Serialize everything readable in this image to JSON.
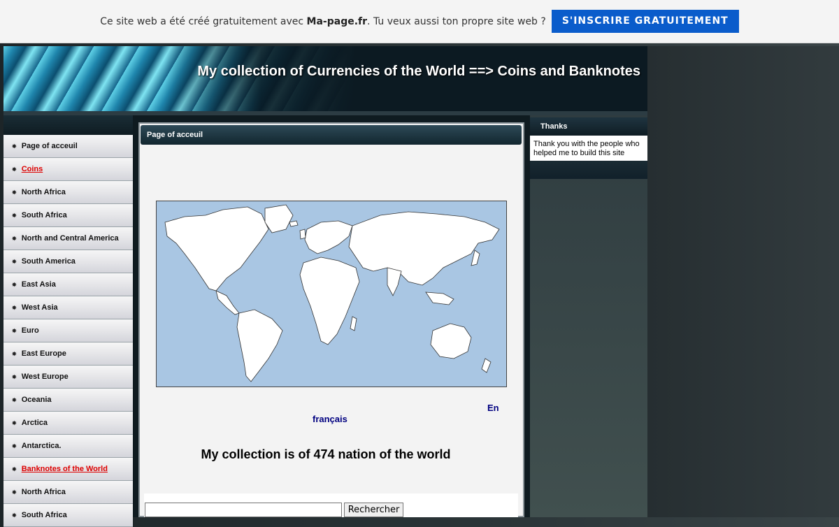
{
  "promo": {
    "text_before": "Ce site web a été créé gratuitement avec ",
    "brand": "Ma-page.fr",
    "text_after": ". Tu veux aussi ton propre site web ?",
    "button": "S'INSCRIRE GRATUITEMENT"
  },
  "banner": {
    "title": "My collection of Currencies of the World ==> Coins and Banknotes"
  },
  "nav": {
    "items": [
      {
        "label": "Page of acceuil",
        "active": false
      },
      {
        "label": "Coins",
        "active": true
      },
      {
        "label": "North Africa",
        "active": false
      },
      {
        "label": "South Africa",
        "active": false
      },
      {
        "label": "North and Central America",
        "active": false
      },
      {
        "label": "South America",
        "active": false
      },
      {
        "label": "East Asia",
        "active": false
      },
      {
        "label": "West Asia",
        "active": false
      },
      {
        "label": "Euro",
        "active": false
      },
      {
        "label": "East Europe",
        "active": false
      },
      {
        "label": "West Europe",
        "active": false
      },
      {
        "label": "Oceania",
        "active": false
      },
      {
        "label": "Arctica",
        "active": false
      },
      {
        "label": "Antarctica.",
        "active": false
      },
      {
        "label": "Banknotes of the World",
        "active": true
      },
      {
        "label": "North Africa",
        "active": false
      },
      {
        "label": "South Africa",
        "active": false
      }
    ]
  },
  "main": {
    "header": "Page of acceuil",
    "lang_en": "En",
    "lang_fr": "français",
    "collection_text": "My collection is of 474 nation of the world",
    "search_button": "Rechercher",
    "search_value": ""
  },
  "sidebar": {
    "title": "Thanks",
    "text": "Thank you with the people who helped me to build this site"
  },
  "colors": {
    "accent": "#0a5ccb",
    "active_link": "#dd0000",
    "lang_link": "#000080",
    "map_ocean": "#a9c6e3"
  }
}
